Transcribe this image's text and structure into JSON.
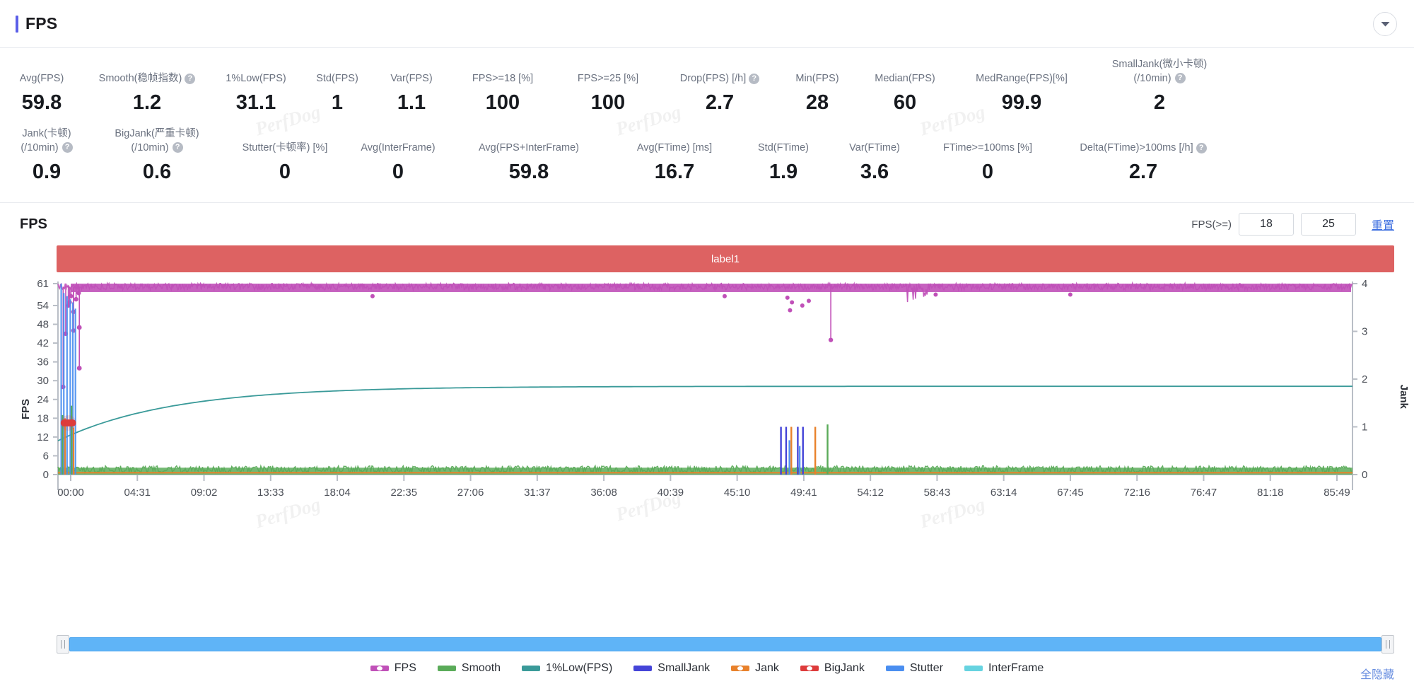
{
  "header": {
    "title": "FPS",
    "collapse_icon": "chevron-down-icon"
  },
  "metrics_row1": [
    {
      "label": "Avg(FPS)",
      "value": "59.8",
      "help": false
    },
    {
      "label": "Smooth(稳帧指数)",
      "value": "1.2",
      "help": true
    },
    {
      "label": "1%Low(FPS)",
      "value": "31.1",
      "help": false
    },
    {
      "label": "Std(FPS)",
      "value": "1",
      "help": false
    },
    {
      "label": "Var(FPS)",
      "value": "1.1",
      "help": false
    },
    {
      "label": "FPS>=18 [%]",
      "value": "100",
      "help": false
    },
    {
      "label": "FPS>=25 [%]",
      "value": "100",
      "help": false
    },
    {
      "label": "Drop(FPS) [/h]",
      "value": "2.7",
      "help": true
    },
    {
      "label": "Min(FPS)",
      "value": "28",
      "help": false
    },
    {
      "label": "Median(FPS)",
      "value": "60",
      "help": false
    },
    {
      "label": "MedRange(FPS)[%]",
      "value": "99.9",
      "help": false
    },
    {
      "label": "SmallJank(微小卡顿)",
      "label2": "(/10min)",
      "value": "2",
      "help": true
    }
  ],
  "metrics_row2": [
    {
      "label": "Jank(卡顿)",
      "label2": "(/10min)",
      "value": "0.9",
      "help": true
    },
    {
      "label": "BigJank(严重卡顿)",
      "label2": "(/10min)",
      "value": "0.6",
      "help": true
    },
    {
      "label": "Stutter(卡顿率) [%]",
      "value": "0",
      "help": false
    },
    {
      "label": "Avg(InterFrame)",
      "value": "0",
      "help": false
    },
    {
      "label": "Avg(FPS+InterFrame)",
      "value": "59.8",
      "help": false
    },
    {
      "label": "Avg(FTime) [ms]",
      "value": "16.7",
      "help": false
    },
    {
      "label": "Std(FTime)",
      "value": "1.9",
      "help": false
    },
    {
      "label": "Var(FTime)",
      "value": "3.6",
      "help": false
    },
    {
      "label": "FTime>=100ms [%]",
      "value": "0",
      "help": false
    },
    {
      "label": "Delta(FTime)>100ms [/h]",
      "value": "2.7",
      "help": true
    }
  ],
  "chart_section": {
    "title": "FPS",
    "filter_label": "FPS(>=)",
    "filter_min": "18",
    "filter_max": "25",
    "filter_min_placeholder": "18",
    "filter_max_placeholder": "25",
    "reset_label": "重置",
    "series_label_bar": "label1",
    "hide_all_label": "全隐藏"
  },
  "watermarks": [
    "PerfDog",
    "PerfDog",
    "PerfDog",
    "PerfDog",
    "PerfDog",
    "PerfDog"
  ],
  "colors": {
    "accent": "#5b5fe8",
    "label_bar": "#dd6262",
    "fps": "#c050b8",
    "smooth": "#5aab59",
    "low1": "#3a9a99",
    "smalljank": "#4444d8",
    "jank": "#e8812b",
    "bigjank": "#dd3b3b",
    "stutter": "#4a8ef0",
    "interframe": "#66d3e0",
    "link": "#3c6ee0",
    "scrollbar": "#5fb4f7"
  },
  "chart_data": {
    "type": "line",
    "title": "FPS",
    "xlabel": "",
    "ylabel": "FPS",
    "y2label": "Jank",
    "ylim": [
      0,
      61
    ],
    "y2lim": [
      0,
      4
    ],
    "yticks": [
      0,
      6,
      12,
      18,
      24,
      30,
      36,
      42,
      48,
      54,
      61
    ],
    "y2ticks": [
      0,
      1,
      2,
      3,
      4
    ],
    "xticks": [
      "00:00",
      "04:31",
      "09:02",
      "13:33",
      "18:04",
      "22:35",
      "27:06",
      "31:37",
      "36:08",
      "40:39",
      "45:10",
      "49:41",
      "54:12",
      "58:43",
      "63:14",
      "67:45",
      "72:16",
      "76:47",
      "81:18",
      "85:49"
    ],
    "grid": false,
    "legend_position": "bottom",
    "legend": [
      {
        "name": "FPS",
        "color": "#c050b8",
        "marker": "dotted"
      },
      {
        "name": "Smooth",
        "color": "#5aab59",
        "marker": "line"
      },
      {
        "name": "1%Low(FPS)",
        "color": "#3a9a99",
        "marker": "line"
      },
      {
        "name": "SmallJank",
        "color": "#4444d8",
        "marker": "line"
      },
      {
        "name": "Jank",
        "color": "#e8812b",
        "marker": "dotted"
      },
      {
        "name": "BigJank",
        "color": "#dd3b3b",
        "marker": "dotted"
      },
      {
        "name": "Stutter",
        "color": "#4a8ef0",
        "marker": "line"
      },
      {
        "name": "InterFrame",
        "color": "#66d3e0",
        "marker": "line"
      }
    ],
    "series": [
      {
        "name": "FPS",
        "axis": "left",
        "description": "dense magenta band near 59-61 fps for entire run, with early dropouts to 28-55 at ~00:05-00:20 and isolated dips to ~42 and ~53 near 63:14",
        "typical_value": 60,
        "min": 28,
        "max": 61
      },
      {
        "name": "Smooth",
        "axis": "left",
        "description": "dense green noise band between 0 and 2 fps across the whole timeline, spikes to ~18-22 at start",
        "typical_value": 1.2,
        "min": 0,
        "max": 22
      },
      {
        "name": "1%Low(FPS)",
        "axis": "left",
        "description": "teal curve rising from ~11 at 00:00 asymptotically to ~28 by 85:49",
        "start_value": 11,
        "end_value": 28
      },
      {
        "name": "SmallJank",
        "axis": "right",
        "description": "blue vertical spikes to 1 at start and near 63:14",
        "typical_value": 0,
        "max": 1
      },
      {
        "name": "Jank",
        "axis": "right",
        "description": "orange flat line at 0 with spikes to 1 near 63:14",
        "typical_value": 0,
        "max": 1
      },
      {
        "name": "BigJank",
        "axis": "right",
        "description": "red markers clustered at 18 fps region at start",
        "typical_value": 0,
        "max": 1
      },
      {
        "name": "Stutter",
        "axis": "left",
        "description": "blue vertical bars at start of timeline reaching 0-61",
        "typical_value": 0
      },
      {
        "name": "InterFrame",
        "axis": "left",
        "description": "cyan, flat at 0",
        "typical_value": 0
      }
    ]
  }
}
